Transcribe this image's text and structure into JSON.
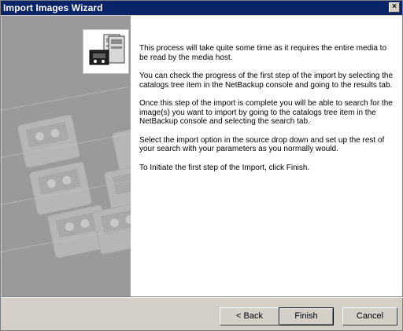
{
  "window": {
    "title": "Import Images Wizard",
    "close_label": "×"
  },
  "content": {
    "paragraphs": [
      "This process will take quite some time as it requires the entire media to be read by the media host.",
      "You can check the progress of the first step of the import by selecting the catalogs tree item in the NetBackup console and going to the results tab.",
      "Once this step of the import is complete you will be able to search for the image(s) you want to import by going to the catalogs tree item in the NetBackup console and selecting the search tab.",
      "Select the import option in the source drop down and set up the rest of your search with your parameters as you normally would.",
      "To Initiate the first step of the Import, click Finish."
    ]
  },
  "buttons": {
    "back": "< Back",
    "finish": "Finish",
    "cancel": "Cancel"
  },
  "icons": {
    "wizard": "import-media-icon",
    "watermark": "tape-cartridges-watermark"
  }
}
